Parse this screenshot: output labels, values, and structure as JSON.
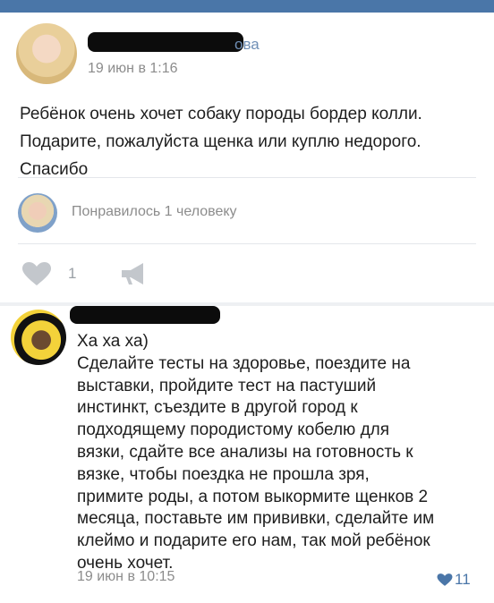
{
  "post": {
    "author_name_visible_tail": "ова",
    "date": "19 июн в 1:16",
    "text": "Ребёнок очень хочет собаку породы бордер колли. Подарите, пожалуйста щенка или куплю недорого. Спасибо",
    "liked_by": "Понравилось 1 человеку",
    "like_count": "1"
  },
  "comment": {
    "lines": [
      "Ха ха ха)",
      "Сделайте тесты на здоровье, поездите на",
      "выставки, пройдите тест на пастуший",
      "инстинкт, съездите в другой город к",
      "подходящему породистому кобелю для",
      "вязки, сдайте все анализы на готовность к",
      "вязке, чтобы поездка не прошла зря,",
      "примите роды, а потом выкормите щенков 2",
      "месяца, поставьте им прививки, сделайте им",
      "клеймо и подарите его нам, так мой ребёнок",
      "очень хочет."
    ],
    "date": "19 июн в 10:15",
    "like_count": "11"
  },
  "colors": {
    "accent": "#4a76a8",
    "meta_gray": "#8c8c8c",
    "icon_gray": "#c3c7cc",
    "redaction": "#0c0c0c"
  },
  "icons": [
    "heart-icon",
    "megaphone-icon",
    "liked-heart-icon"
  ]
}
